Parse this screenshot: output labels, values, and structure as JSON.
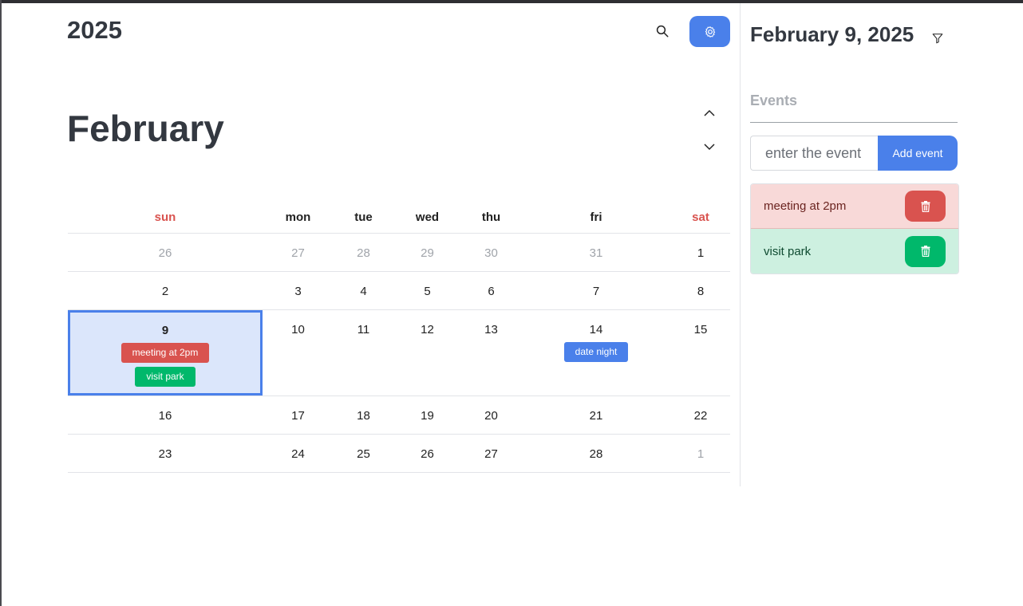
{
  "header": {
    "year": "2025",
    "month": "February"
  },
  "calendar": {
    "weekdays": [
      "sun",
      "mon",
      "tue",
      "wed",
      "thu",
      "fri",
      "sat"
    ],
    "weeks": [
      [
        {
          "d": "26",
          "muted": true
        },
        {
          "d": "27",
          "muted": true
        },
        {
          "d": "28",
          "muted": true
        },
        {
          "d": "29",
          "muted": true
        },
        {
          "d": "30",
          "muted": true
        },
        {
          "d": "31",
          "muted": true
        },
        {
          "d": "1"
        }
      ],
      [
        {
          "d": "2"
        },
        {
          "d": "3"
        },
        {
          "d": "4"
        },
        {
          "d": "5"
        },
        {
          "d": "6"
        },
        {
          "d": "7"
        },
        {
          "d": "8"
        }
      ],
      [
        {
          "d": "9",
          "selected": true,
          "events": [
            {
              "label": "meeting at 2pm",
              "color": "red"
            },
            {
              "label": "visit park",
              "color": "green"
            }
          ]
        },
        {
          "d": "10"
        },
        {
          "d": "11"
        },
        {
          "d": "12"
        },
        {
          "d": "13"
        },
        {
          "d": "14",
          "events": [
            {
              "label": "date night",
              "color": "blue"
            }
          ]
        },
        {
          "d": "15"
        }
      ],
      [
        {
          "d": "16"
        },
        {
          "d": "17"
        },
        {
          "d": "18"
        },
        {
          "d": "19"
        },
        {
          "d": "20"
        },
        {
          "d": "21"
        },
        {
          "d": "22"
        }
      ],
      [
        {
          "d": "23"
        },
        {
          "d": "24"
        },
        {
          "d": "25"
        },
        {
          "d": "26"
        },
        {
          "d": "27"
        },
        {
          "d": "28"
        },
        {
          "d": "1",
          "muted": true
        }
      ]
    ]
  },
  "sidebar": {
    "selected_date": "February 9, 2025",
    "events_title": "Events",
    "input_placeholder": "enter the event",
    "add_button": "Add event",
    "events": [
      {
        "label": "meeting at 2pm",
        "color": "red"
      },
      {
        "label": "visit park",
        "color": "green"
      }
    ]
  },
  "colors": {
    "accent": "#4a80ea",
    "danger": "#d9534f",
    "success": "#00b86b",
    "selected_bg": "#dbe6fb"
  },
  "icons": {
    "search": "search-icon",
    "settings": "gear-icon",
    "up": "chevron-up-icon",
    "down": "chevron-down-icon",
    "filter": "filter-icon",
    "delete": "trash-icon"
  }
}
